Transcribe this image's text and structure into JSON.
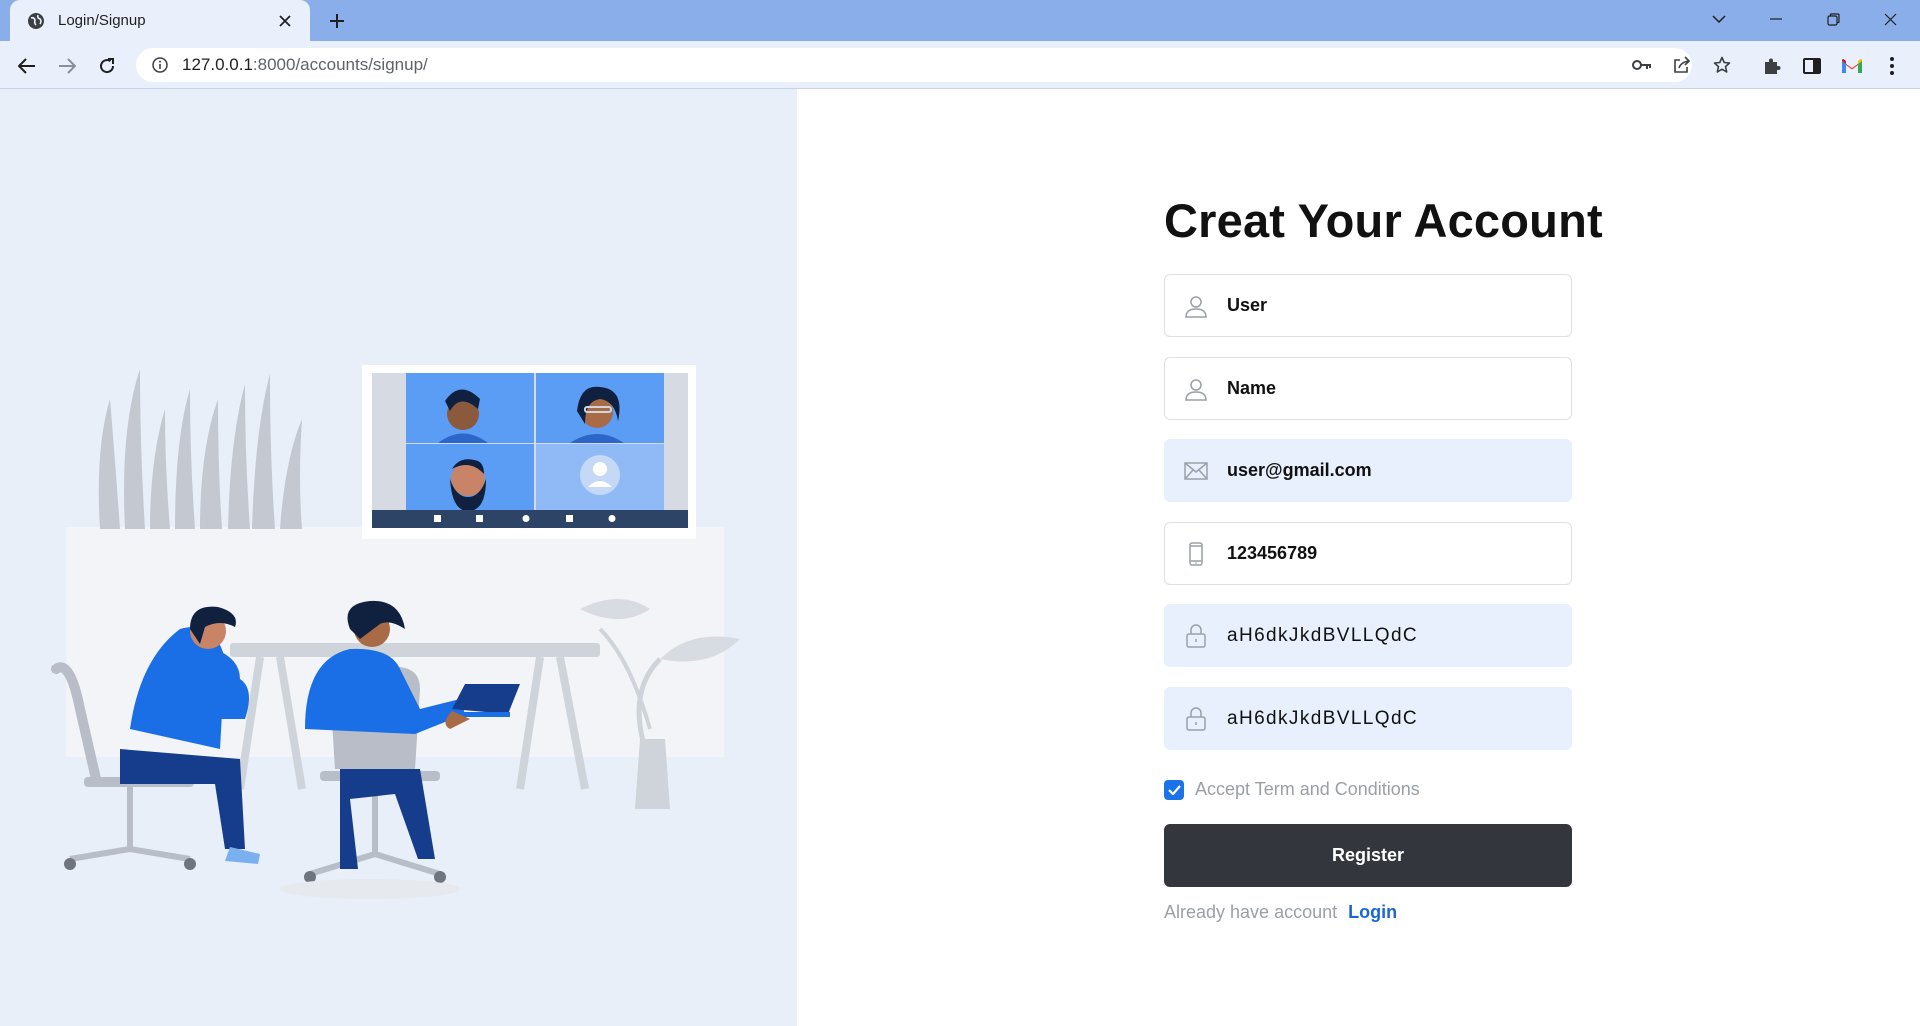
{
  "browser": {
    "tab_title": "Login/Signup",
    "url_host": "127.0.0.1",
    "url_rest": ":8000/accounts/signup/"
  },
  "icons": {
    "favicon": "globe-icon",
    "tab_close": "close-icon",
    "new_tab": "plus-icon",
    "tab_search": "chevron-down-icon",
    "minimize": "minimize-icon",
    "restore": "restore-icon",
    "close_window": "close-icon",
    "back": "back-arrow-icon",
    "forward": "forward-arrow-icon",
    "reload": "reload-icon",
    "site_info": "info-icon",
    "password_key": "key-icon",
    "share": "share-icon",
    "bookmark": "star-icon",
    "extensions": "puzzle-icon",
    "side_panel": "side-panel-icon",
    "gmail": "gmail-icon",
    "menu": "kebab-menu-icon"
  },
  "colors": {
    "left_panel_bg": "#e8eff9",
    "filled_field_bg": "#e8effd",
    "register_bg": "#33363c",
    "link": "#1a66d6",
    "checkbox": "#1a73e8"
  },
  "signup": {
    "heading": "Creat Your Account",
    "fields": [
      {
        "icon": "user-icon",
        "value": "User",
        "filled": false
      },
      {
        "icon": "user-icon",
        "value": "Name",
        "filled": false
      },
      {
        "icon": "envelope-icon",
        "value": "user@gmail.com",
        "filled": true
      },
      {
        "icon": "phone-icon",
        "value": "123456789",
        "filled": false
      },
      {
        "icon": "lock-icon",
        "value": "aH6dkJkdBVLLQdC",
        "filled": true
      },
      {
        "icon": "lock-icon",
        "value": "aH6dkJkdBVLLQdC",
        "filled": true
      }
    ],
    "terms_label": "Accept Term and Conditions",
    "terms_checked": true,
    "register_label": "Register",
    "already_text": "Already have account",
    "login_label": "Login"
  }
}
